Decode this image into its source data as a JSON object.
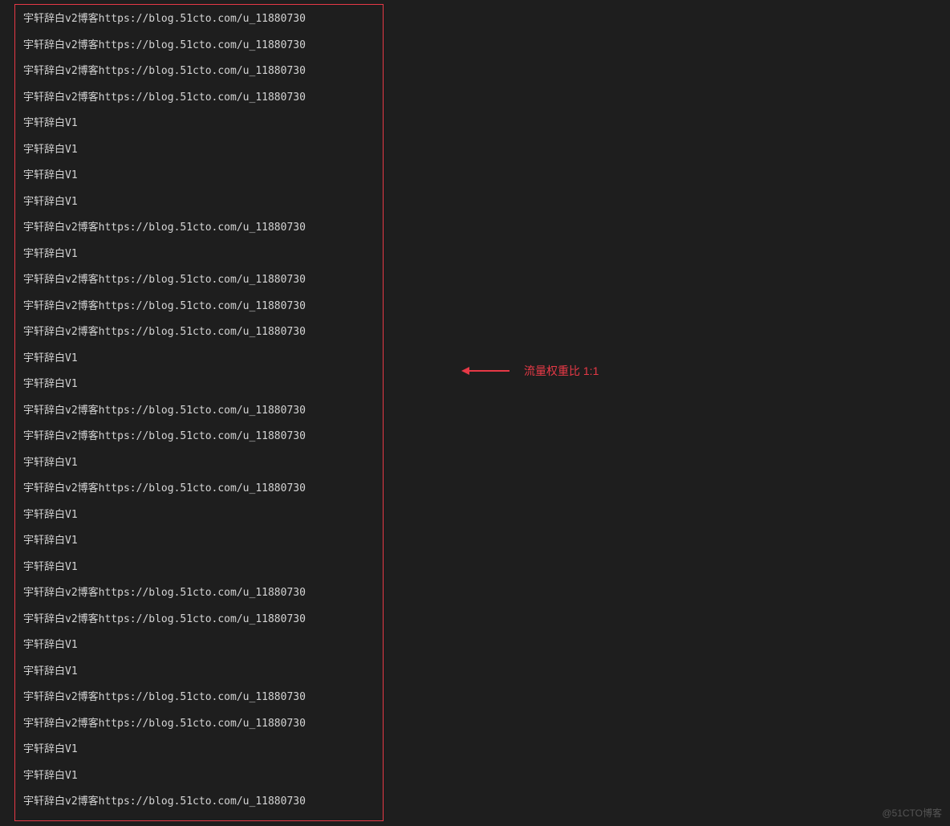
{
  "terminal": {
    "lines": [
      "宇轩辞白v2博客https://blog.51cto.com/u_11880730",
      "宇轩辞白v2博客https://blog.51cto.com/u_11880730",
      "宇轩辞白v2博客https://blog.51cto.com/u_11880730",
      "宇轩辞白v2博客https://blog.51cto.com/u_11880730",
      "宇轩辞白V1",
      "宇轩辞白V1",
      "宇轩辞白V1",
      "宇轩辞白V1",
      "宇轩辞白v2博客https://blog.51cto.com/u_11880730",
      "宇轩辞白V1",
      "宇轩辞白v2博客https://blog.51cto.com/u_11880730",
      "宇轩辞白v2博客https://blog.51cto.com/u_11880730",
      "宇轩辞白v2博客https://blog.51cto.com/u_11880730",
      "宇轩辞白V1",
      "宇轩辞白V1",
      "宇轩辞白v2博客https://blog.51cto.com/u_11880730",
      "宇轩辞白v2博客https://blog.51cto.com/u_11880730",
      "宇轩辞白V1",
      "宇轩辞白v2博客https://blog.51cto.com/u_11880730",
      "宇轩辞白V1",
      "宇轩辞白V1",
      "宇轩辞白V1",
      "宇轩辞白v2博客https://blog.51cto.com/u_11880730",
      "宇轩辞白v2博客https://blog.51cto.com/u_11880730",
      "宇轩辞白V1",
      "宇轩辞白V1",
      "宇轩辞白v2博客https://blog.51cto.com/u_11880730",
      "宇轩辞白v2博客https://blog.51cto.com/u_11880730",
      "宇轩辞白V1",
      "宇轩辞白V1",
      "宇轩辞白v2博客https://blog.51cto.com/u_11880730"
    ]
  },
  "annotation": {
    "text": "流量权重比 1:1"
  },
  "watermark": "@51CTO博客"
}
